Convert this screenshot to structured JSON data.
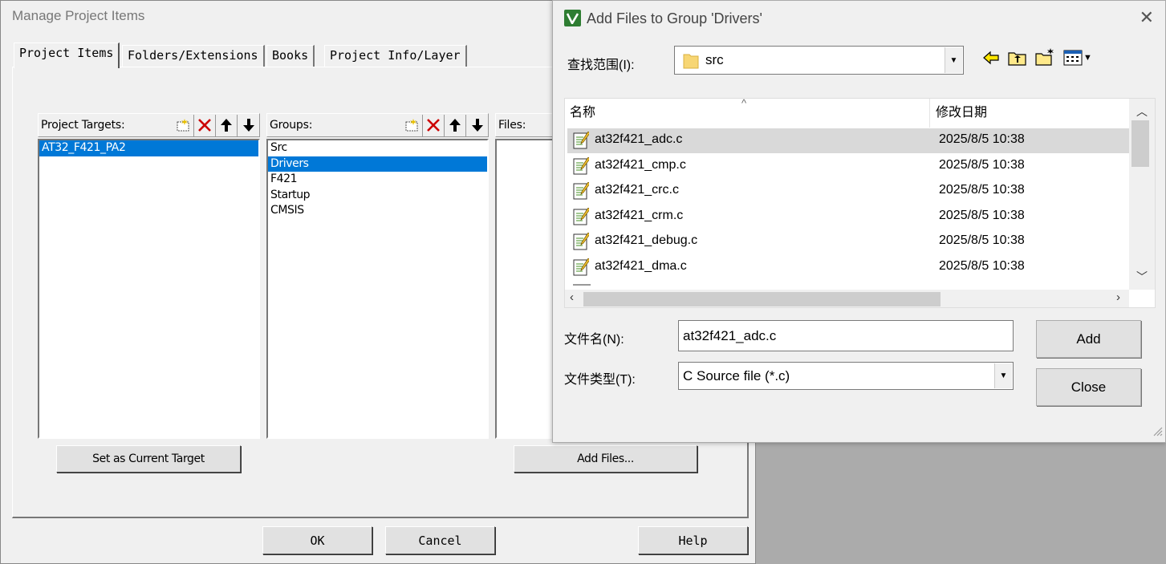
{
  "manage_window": {
    "title": "Manage Project Items",
    "tabs": [
      "Project Items",
      "Folders/Extensions",
      "Books",
      "Project Info/Layer"
    ],
    "targets_label": "Project Targets:",
    "targets": [
      "AT32_F421_PA2"
    ],
    "groups_label": "Groups:",
    "groups": [
      "Src",
      "Drivers",
      "F421",
      "Startup",
      "CMSIS"
    ],
    "selected_group": "Drivers",
    "files_label": "Files:",
    "set_target_button": "Set as Current Target",
    "add_files_button": "Add Files...",
    "ok_button": "OK",
    "cancel_button": "Cancel",
    "help_button": "Help"
  },
  "add_dialog": {
    "title": "Add Files to Group 'Drivers'",
    "look_in_label": "查找范围(I):",
    "look_in_value": "src",
    "col_name": "名称",
    "col_date": "修改日期",
    "files": [
      {
        "name": "at32f421_adc.c",
        "date": "2025/8/5 10:38"
      },
      {
        "name": "at32f421_cmp.c",
        "date": "2025/8/5 10:38"
      },
      {
        "name": "at32f421_crc.c",
        "date": "2025/8/5 10:38"
      },
      {
        "name": "at32f421_crm.c",
        "date": "2025/8/5 10:38"
      },
      {
        "name": "at32f421_debug.c",
        "date": "2025/8/5 10:38"
      },
      {
        "name": "at32f421_dma.c",
        "date": "2025/8/5 10:38"
      }
    ],
    "filename_label": "文件名(N):",
    "filename_value": "at32f421_adc.c",
    "filetype_label": "文件类型(T):",
    "filetype_value": "C Source file (*.c)",
    "add_button": "Add",
    "close_button": "Close"
  }
}
